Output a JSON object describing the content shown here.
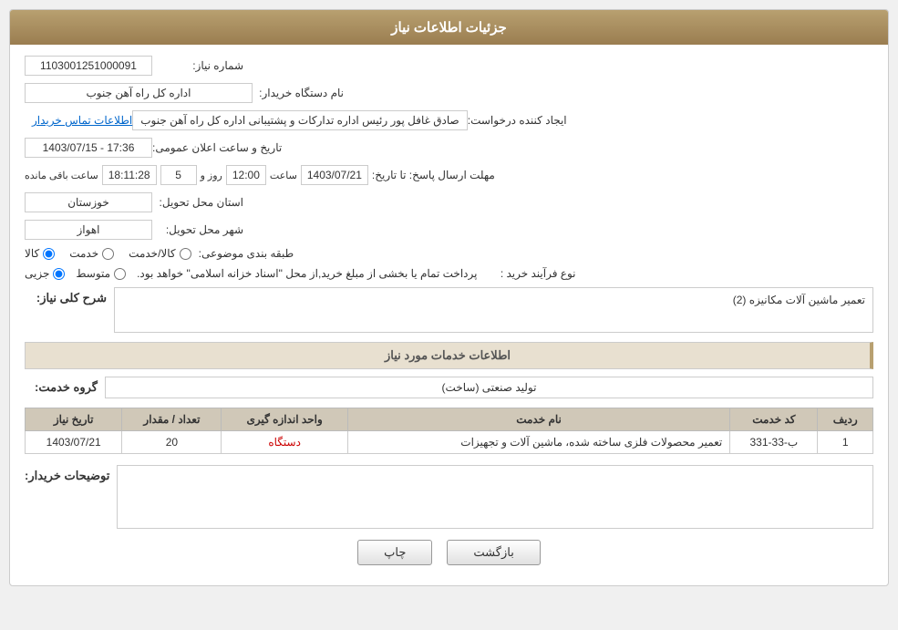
{
  "page": {
    "header": "جزئیات اطلاعات نیاز",
    "sections": {
      "main_info_label": "شماره نیاز:",
      "need_number": "1103001251000091",
      "buyer_org_label": "نام دستگاه خریدار:",
      "buyer_org": "اداره کل راه آهن جنوب",
      "creator_label": "ایجاد کننده درخواست:",
      "creator": "صادق غافل پور رئیس اداره تدارکات و پشتیبانی اداره کل راه آهن جنوب",
      "contact_link": "اطلاعات تماس خریدار",
      "announce_datetime_label": "تاریخ و ساعت اعلان عمومی:",
      "announce_datetime": "1403/07/15 - 17:36",
      "deadline_label": "مهلت ارسال پاسخ: تا تاریخ:",
      "deadline_date": "1403/07/21",
      "deadline_time_label": "ساعت",
      "deadline_time": "12:00",
      "deadline_days_label": "روز و",
      "deadline_days": "5",
      "deadline_remaining_label": "ساعت باقی مانده",
      "deadline_remaining": "18:11:28",
      "province_label": "استان محل تحویل:",
      "province": "خوزستان",
      "city_label": "شهر محل تحویل:",
      "city": "اهواز",
      "subject_label": "طبقه بندی موضوعی:",
      "subject_radio1": "کالا",
      "subject_radio2": "خدمت",
      "subject_radio3": "کالا/خدمت",
      "subject_selected": "کالا",
      "process_label": "نوع فرآیند خرید :",
      "process_radio1": "جزیی",
      "process_radio2": "متوسط",
      "process_desc": "پرداخت تمام یا بخشی از مبلغ خرید,از محل \"اسناد خزانه اسلامی\" خواهد بود.",
      "description_section_label": "شرح کلی نیاز:",
      "description_text": "تعمیر ماشین آلات مکانیزه (2)",
      "services_section_label": "اطلاعات خدمات مورد نیاز",
      "service_group_label": "گروه خدمت:",
      "service_group_value": "تولید صنعتی (ساخت)",
      "table": {
        "headers": [
          "ردیف",
          "کد خدمت",
          "نام خدمت",
          "واحد اندازه گیری",
          "تعداد / مقدار",
          "تاریخ نیاز"
        ],
        "rows": [
          {
            "row_num": "1",
            "service_code": "ب-33-331",
            "service_name": "تعمیر محصولات فلزی ساخته شده، ماشین آلات و تجهیزات",
            "unit": "دستگاه",
            "quantity": "20",
            "date": "1403/07/21"
          }
        ]
      },
      "buyer_notes_label": "توضیحات خریدار:",
      "buyer_notes": "",
      "btn_print": "چاپ",
      "btn_back": "بازگشت"
    }
  }
}
